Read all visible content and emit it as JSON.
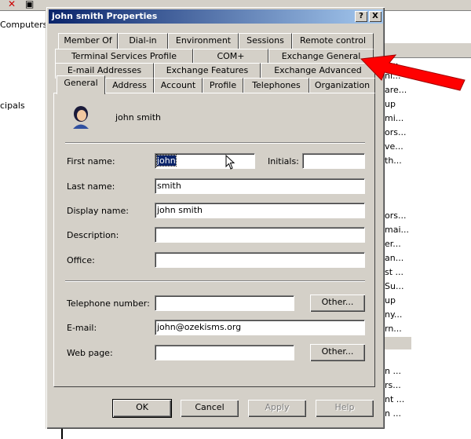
{
  "background": {
    "left_items": [
      "Computers",
      "cipals"
    ],
    "right_items": [
      "fi...",
      "ni...",
      "are...",
      "up",
      "mi...",
      "ors...",
      "ve...",
      "th...",
      "ors...",
      "mai...",
      "er...",
      "an...",
      "st ...",
      "Su...",
      "up",
      "ny...",
      "rn...",
      "n ...",
      "rs...",
      "nt ...",
      "n ..."
    ]
  },
  "dialog": {
    "title": "john smith Properties",
    "help_button": "?",
    "close_button": "X",
    "tabs_row1": [
      "Member Of",
      "Dial-in",
      "Environment",
      "Sessions",
      "Remote control"
    ],
    "tabs_row2": [
      "Terminal Services Profile",
      "COM+",
      "Exchange General"
    ],
    "tabs_row3": [
      "E-mail Addresses",
      "Exchange Features",
      "Exchange Advanced"
    ],
    "tabs_row4": [
      "General",
      "Address",
      "Account",
      "Profile",
      "Telephones",
      "Organization"
    ],
    "user_display": "john smith",
    "labels": {
      "first_name": "First name:",
      "initials": "Initials:",
      "last_name": "Last name:",
      "display_name": "Display name:",
      "description": "Description:",
      "office": "Office:",
      "telephone": "Telephone number:",
      "email": "E-mail:",
      "web_page": "Web page:"
    },
    "values": {
      "first_name": "john",
      "initials": "",
      "last_name": "smith",
      "display_name": "john smith",
      "description": "",
      "office": "",
      "telephone": "",
      "email": "john@ozekisms.org",
      "web_page": ""
    },
    "other_button": "Other...",
    "buttons": {
      "ok": "OK",
      "cancel": "Cancel",
      "apply": "Apply",
      "help": "Help"
    }
  },
  "colors": {
    "title_gradient_start": "#0a246a",
    "title_gradient_end": "#a6caf0",
    "arrow": "#ff0000",
    "dialog_face": "#d4d0c8"
  }
}
